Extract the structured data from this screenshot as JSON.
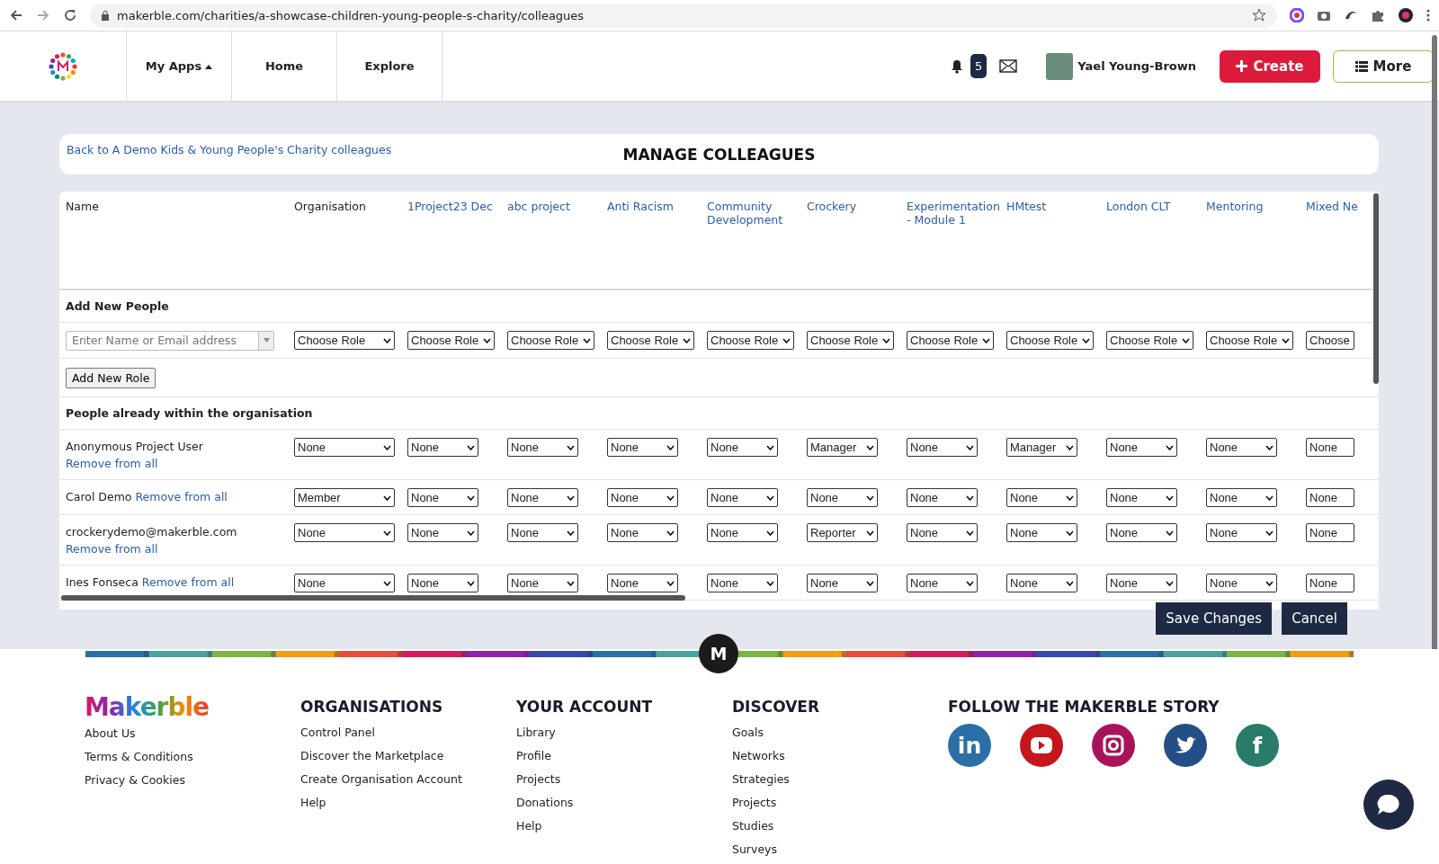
{
  "browser": {
    "url": "makerble.com/charities/a-showcase-children-young-people-s-charity/colleagues"
  },
  "nav": {
    "items": [
      {
        "label": "My Apps",
        "kind": "menu"
      },
      {
        "label": "Home",
        "kind": "link"
      },
      {
        "label": "Explore",
        "kind": "link"
      }
    ],
    "notifications": "5",
    "user": "Yael Young-Brown",
    "create": "Create",
    "more": "More"
  },
  "header": {
    "back_link": "Back to A Demo Kids & Young People's Charity colleagues",
    "title": "MANAGE COLLEAGUES"
  },
  "table": {
    "columns": [
      {
        "label": "Name",
        "kind": "plain"
      },
      {
        "label": "Organisation",
        "kind": "plain"
      },
      {
        "label": "1Project23 Dec",
        "kind": "link"
      },
      {
        "label": "abc project",
        "kind": "link"
      },
      {
        "label": "Anti Racism",
        "kind": "link"
      },
      {
        "label": "Community Development",
        "kind": "link"
      },
      {
        "label": "Crockery",
        "kind": "link"
      },
      {
        "label": "Experimentation - Module 1",
        "kind": "link"
      },
      {
        "label": "HMtest",
        "kind": "link"
      },
      {
        "label": "London CLT",
        "kind": "link"
      },
      {
        "label": "Mentoring",
        "kind": "link"
      },
      {
        "label": "Mixed Ne",
        "kind": "link"
      }
    ],
    "add_section": "Add New People",
    "name_placeholder": "Enter Name or Email address",
    "role_choices": [
      "Choose Role",
      "Choose Role",
      "Choose Role",
      "Choose Role",
      "Choose Role",
      "Choose Role",
      "Choose Role",
      "Choose Role",
      "Choose Role",
      "Choose Role",
      "Choose"
    ],
    "add_role": "Add New Role",
    "people_section": "People already within the organisation",
    "people": [
      {
        "name": "Anonymous Project User",
        "remove": "Remove from all",
        "roles": [
          "None",
          "None",
          "None",
          "None",
          "None",
          "Manager",
          "None",
          "Manager",
          "None",
          "None",
          "None"
        ]
      },
      {
        "name": "Carol Demo",
        "remove": "Remove from all",
        "roles": [
          "Member",
          "None",
          "None",
          "None",
          "None",
          "None",
          "None",
          "None",
          "None",
          "None",
          "None"
        ]
      },
      {
        "name": "crockerydemo@makerble.com",
        "remove": "Remove from all",
        "roles": [
          "None",
          "None",
          "None",
          "None",
          "None",
          "Reporter",
          "None",
          "None",
          "None",
          "None",
          "None"
        ]
      },
      {
        "name": "Ines Fonseca",
        "remove": "Remove from all",
        "roles": [
          "None",
          "None",
          "None",
          "None",
          "None",
          "None",
          "None",
          "None",
          "None",
          "None",
          "None"
        ]
      }
    ]
  },
  "actions": {
    "save": "Save Changes",
    "cancel": "Cancel"
  },
  "footer": {
    "columns": [
      {
        "heading": "ORGANISATIONS",
        "links": [
          "Control Panel",
          "Discover the Marketplace",
          "Create Organisation Account",
          "Help"
        ]
      },
      {
        "heading": "YOUR ACCOUNT",
        "links": [
          "Library",
          "Profile",
          "Projects",
          "Donations",
          "Help"
        ]
      },
      {
        "heading": "DISCOVER",
        "links": [
          "Goals",
          "Networks",
          "Strategies",
          "Projects",
          "Studies",
          "Surveys"
        ]
      }
    ],
    "brand_links": [
      "About Us",
      "Terms & Conditions",
      "Privacy & Cookies"
    ],
    "brand": "Makerble",
    "divider_mark": "M",
    "follow": "FOLLOW THE MAKERBLE STORY",
    "social": [
      {
        "kind": "linkedin",
        "glyph": "in",
        "color": "#2a6fa8"
      },
      {
        "kind": "youtube",
        "color": "#c4161c"
      },
      {
        "kind": "instagram",
        "color": "#a8145a"
      },
      {
        "kind": "twitter",
        "color": "#244f86"
      },
      {
        "kind": "facebook",
        "glyph": "f",
        "color": "#287c68"
      }
    ]
  }
}
